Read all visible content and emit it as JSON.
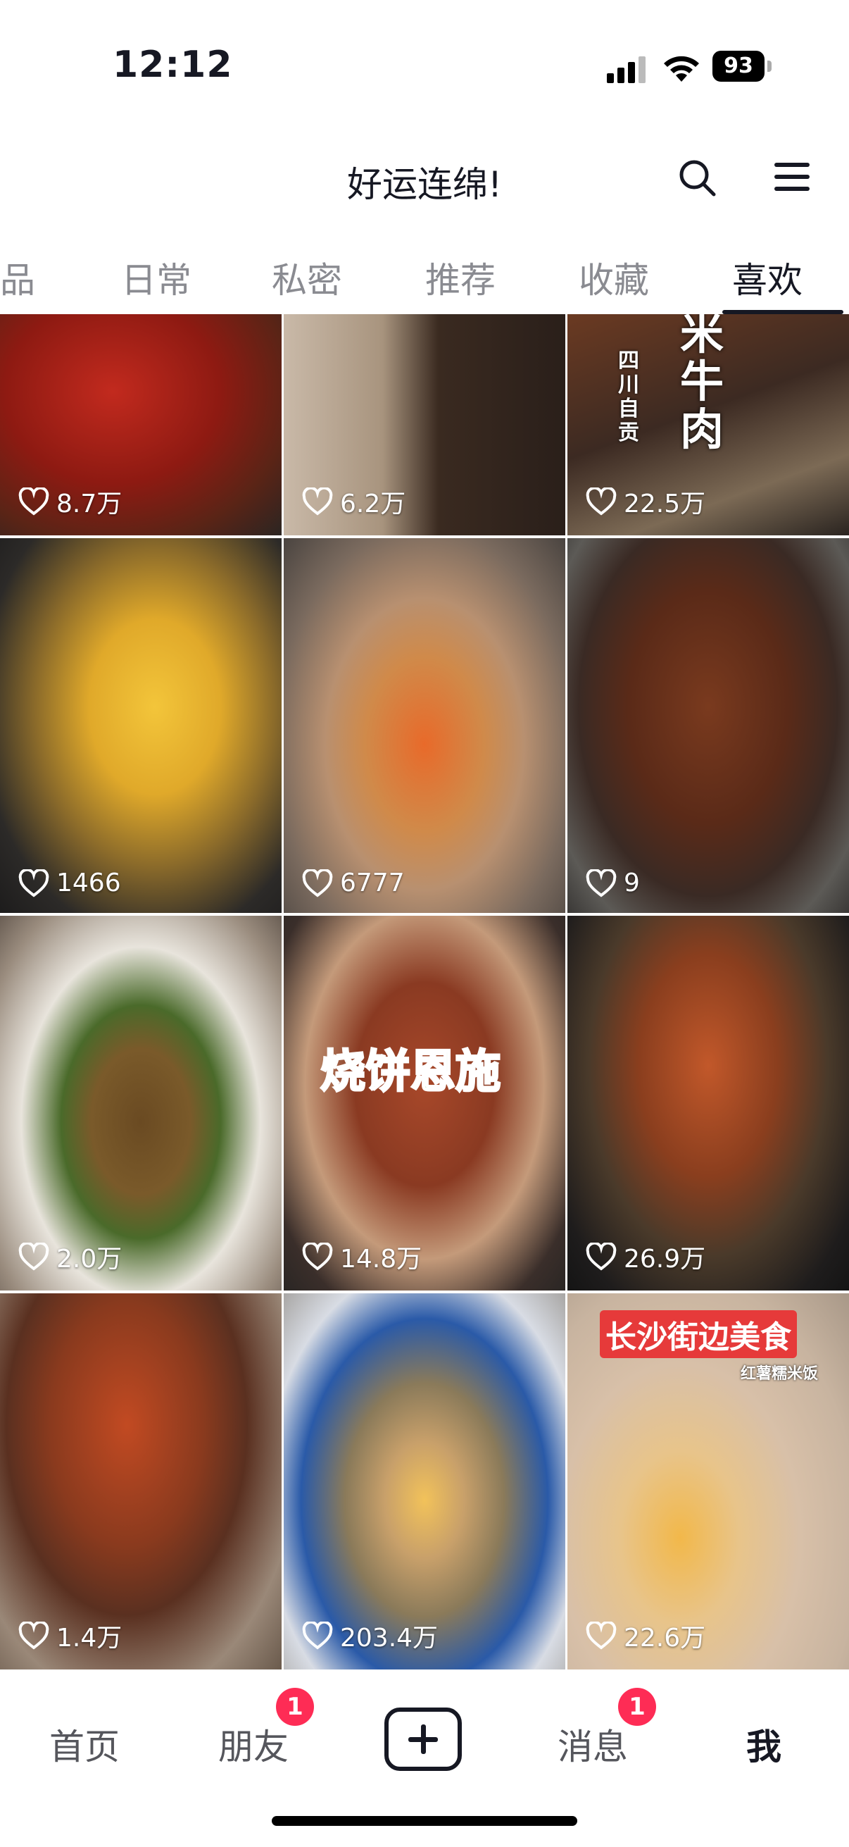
{
  "status_bar": {
    "time": "12:12",
    "battery": "93"
  },
  "header": {
    "title": "好运连绵!"
  },
  "tabs": [
    {
      "label": "品"
    },
    {
      "label": "日常"
    },
    {
      "label": "私密"
    },
    {
      "label": "推荐"
    },
    {
      "label": "收藏"
    },
    {
      "label": "喜欢",
      "active": true
    }
  ],
  "grid": {
    "tiles": [
      {
        "likes": "8.7万"
      },
      {
        "likes": "6.2万"
      },
      {
        "likes": "22.5万",
        "overlay": "米牛肉",
        "caption": "四川自贡"
      },
      {
        "likes": "1466"
      },
      {
        "likes": "6777"
      },
      {
        "likes": "9"
      },
      {
        "likes": "2.0万"
      },
      {
        "likes": "14.8万",
        "overlay": "烧饼恩施"
      },
      {
        "likes": "26.9万"
      },
      {
        "likes": "1.4万"
      },
      {
        "likes": "203.4万"
      },
      {
        "likes": "22.6万",
        "overlay": "长沙街边美食",
        "caption": "红薯糯米饭"
      }
    ]
  },
  "bottom_nav": {
    "home": "首页",
    "friends": "朋友",
    "friends_badge": "1",
    "messages": "消息",
    "messages_badge": "1",
    "me": "我"
  }
}
